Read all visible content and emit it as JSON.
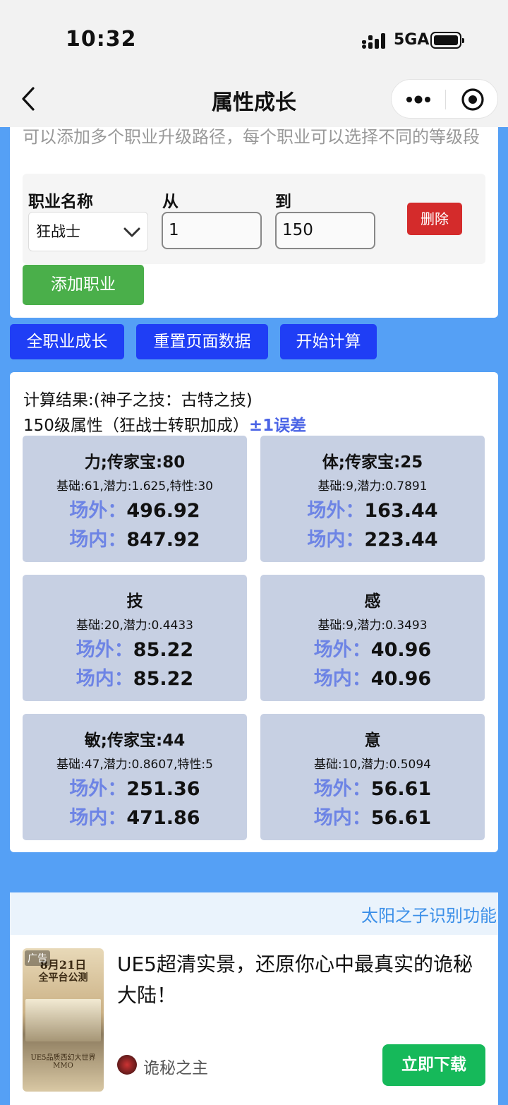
{
  "status_bar": {
    "time": "10:32",
    "network": "5GA"
  },
  "nav": {
    "title": "属性成长"
  },
  "form": {
    "hint": "可以添加多个职业升级路径，每个职业可以选择不同的等级段",
    "labels": {
      "job_name": "职业名称",
      "from": "从",
      "to": "到"
    },
    "job_value": "狂战士",
    "from_value": "1",
    "to_value": "150",
    "delete_label": "删除",
    "add_label": "添加职业"
  },
  "actions": {
    "all_growth": "全职业成长",
    "reset": "重置页面数据",
    "calculate": "开始计算"
  },
  "result": {
    "line1": "计算结果:(神子之技：古特之技)",
    "line2": "150级属性（狂战士转职加成）",
    "error_note": "±1误差",
    "outside_label": "场外：",
    "inside_label": "场内：",
    "stats": [
      {
        "title": "力;传家宝:80",
        "base": "基础:61,潜力:1.625,特性:30",
        "outside": "496.92",
        "inside": "847.92"
      },
      {
        "title": "体;传家宝:25",
        "base": "基础:9,潜力:0.7891",
        "outside": "163.44",
        "inside": "223.44"
      },
      {
        "title": "技",
        "base": "基础:20,潜力:0.4433",
        "outside": "85.22",
        "inside": "85.22"
      },
      {
        "title": "感",
        "base": "基础:9,潜力:0.3493",
        "outside": "40.96",
        "inside": "40.96"
      },
      {
        "title": "敏;传家宝:44",
        "base": "基础:47,潜力:0.8607,特性:5",
        "outside": "251.36",
        "inside": "471.86"
      },
      {
        "title": "意",
        "base": "基础:10,潜力:0.5094",
        "outside": "56.61",
        "inside": "56.61"
      }
    ]
  },
  "marquee": {
    "text": "太阳之子识别功能"
  },
  "ad": {
    "tag": "广告",
    "img_line1": "8月21日",
    "img_line2": "全平台公测",
    "img_line3": "UE5品质西幻大世界MMO",
    "headline": "UE5超清实景，还原你心中最真实的诡秘大陆！",
    "brand": "诡秘之主",
    "download": "立即下载"
  },
  "colors": {
    "page_bg": "#55a0f5",
    "action_button": "#1f3ef5",
    "delete_button": "#d42b2b",
    "add_button": "#4aaf4a",
    "stat_card": "#c7d0e3",
    "stat_label": "#6d84e5",
    "download_button": "#16b95a"
  },
  "icons": [
    "back-arrow-icon",
    "more-dots-icon",
    "record-target-icon",
    "chevron-down-icon",
    "signal-icon",
    "battery-icon"
  ]
}
